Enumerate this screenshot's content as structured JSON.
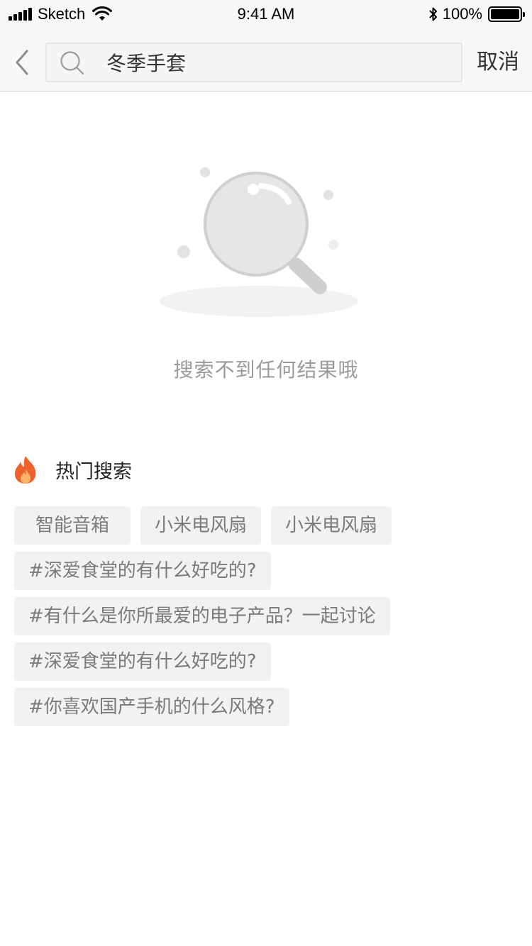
{
  "status_bar": {
    "carrier": "Sketch",
    "time": "9:41 AM",
    "battery": "100%"
  },
  "nav": {
    "search_value": "冬季手套",
    "cancel_label": "取消"
  },
  "empty_state": {
    "message": "搜索不到任何结果哦"
  },
  "hot_search": {
    "title": "热门搜索",
    "tags": [
      "智能音箱",
      "小米电风扇",
      "小米电风扇",
      "#深爱食堂的有什么好吃的?",
      "#有什么是你所最爱的电子产品？一起讨论",
      "#深爱食堂的有什么好吃的?",
      "#你喜欢国产手机的什么风格?"
    ]
  },
  "colors": {
    "accent_fire": "#f0622b",
    "tag_bg": "#f2f2f2",
    "empty_text": "#9a9a9a"
  }
}
